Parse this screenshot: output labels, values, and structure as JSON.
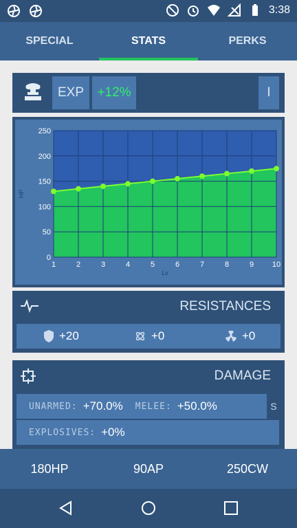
{
  "status": {
    "time": "3:38",
    "icons": [
      "aperture-icon",
      "aperture-icon",
      "do-not-disturb-icon",
      "alarm-icon",
      "wifi-icon",
      "no-signal-icon",
      "battery-icon"
    ]
  },
  "tabs": [
    {
      "label": "SPECIAL"
    },
    {
      "label": "STATS",
      "active": true
    },
    {
      "label": "PERKS"
    }
  ],
  "exp": {
    "icon": "vault-boy-icon",
    "label": "EXP",
    "bonus": "+12%",
    "info_label": "I"
  },
  "chart_data": {
    "type": "area",
    "x": [
      1,
      2,
      3,
      4,
      5,
      6,
      7,
      8,
      9,
      10
    ],
    "values": [
      130,
      135,
      140,
      145,
      150,
      155,
      160,
      165,
      170,
      175
    ],
    "yticks": [
      0,
      50,
      100,
      150,
      200,
      250
    ],
    "ylim": [
      0,
      250
    ],
    "xlim": [
      1,
      10
    ],
    "xlabel": "Lv",
    "ylabel": "HP",
    "grid": true,
    "fill_color": "#22c55e",
    "line_color": "#7cff2e"
  },
  "resistances": {
    "title": "RESISTANCES",
    "values": [
      {
        "icon": "shield-icon",
        "value": "+20"
      },
      {
        "icon": "atom-icon",
        "value": "+0"
      },
      {
        "icon": "radiation-icon",
        "value": "+0"
      }
    ]
  },
  "damage": {
    "title": "DAMAGE",
    "unarmed_label": "UNARMED:",
    "unarmed_value": "+70.0%",
    "melee_label": "MELEE:",
    "melee_value": "+50.0%",
    "side_button": "S",
    "explosives_label": "EXPLOSIVES:",
    "explosives_value": "+0%"
  },
  "summary": {
    "hp": "180HP",
    "ap": "90AP",
    "cw": "250CW"
  },
  "colors": {
    "accent": "#22c55e",
    "panel": "#2f5178",
    "cell": "#4a78ad"
  }
}
